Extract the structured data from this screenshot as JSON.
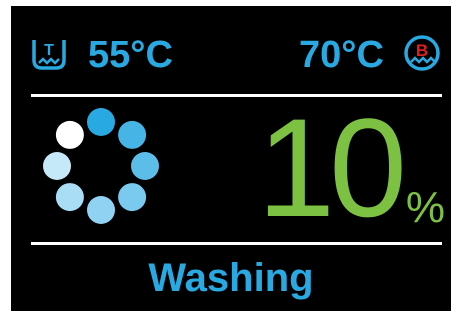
{
  "colors": {
    "background": "#000000",
    "accent_blue": "#29a9e1",
    "progress_green": "#7dc142",
    "divider": "#ffffff",
    "boiler_red": "#e02020"
  },
  "tank": {
    "icon": "tank-thermometer-icon",
    "icon_letter": "T",
    "temperature": "55°C"
  },
  "boiler": {
    "icon": "boiler-icon",
    "icon_letter": "B",
    "temperature": "70°C"
  },
  "progress": {
    "value": "10",
    "unit": "%",
    "spinner_icon": "loading-spinner-icon"
  },
  "status": {
    "label": "Washing"
  }
}
